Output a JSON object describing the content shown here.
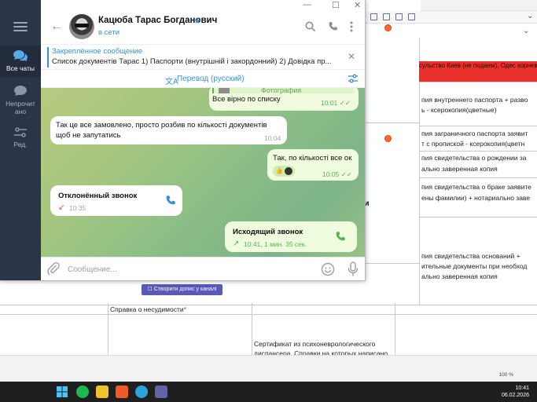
{
  "sidebar": {
    "folders": [
      {
        "label": "Все чаты",
        "active": true
      },
      {
        "label": "Непрочитано",
        "active": false
      },
      {
        "label": "Ред.",
        "active": false
      }
    ]
  },
  "header": {
    "title": "Кацюба Тарас Богданович",
    "status": "в сети"
  },
  "pinned": {
    "title": "Закреплённое сообщение",
    "text": "Список документів Тарас  1) Паспорти (внутрішній і закордонний) 2) Довідка пр..."
  },
  "translate": {
    "label": "Перевод (русский)"
  },
  "messages": {
    "photo": {
      "label": "Фотография",
      "text": "Все вірно по списку",
      "time": "10:01"
    },
    "split": {
      "text": "Так це все замовлено, просто розбив по кількості документів щоб не запутатись",
      "time": "10:04"
    },
    "count": {
      "text": "Так, по кількості все ок",
      "reaction": "👍",
      "time": "10:05"
    },
    "missed_call": {
      "title": "Отклонённый звонок",
      "time": "10:35"
    },
    "outgoing_call": {
      "title": "Исходящий звонок",
      "time": "10:41, 1 мин. 35 сек."
    }
  },
  "composer": {
    "placeholder": "Сообщение..."
  },
  "sheet": {
    "red_header": "сульство Киев (не подаем), Одес корневых)",
    "rows": [
      "пия внутреннего паспорта + разво",
      "ь - ксерокопия(цветные)",
      "пия заграничного паспорта заявит",
      "т с пропиской - ксерокопия(цветн",
      "пия свидетельства о рождении за",
      "ально заверенная копия",
      "пия свидетельства о браке заявите",
      "ены фамилии) + нотариально заве",
      "пия свидетельства оснований +",
      "ительные документы при необход",
      "ально заверенная копия"
    ],
    "bold_fragment": "ми",
    "canal_button": "Створити допис у каналі",
    "row_label": "Справка о несудимости",
    "certificate": [
      "Сертификат из психоневрологического",
      "диспансера. Справки на которых нарисано"
    ],
    "zoom": "100 %"
  },
  "taskbar": {
    "time": "10:41",
    "date": "06.02.2026"
  },
  "colors": {
    "accent": "#3a8fd9",
    "sidebar": "#2b3548",
    "outgoing_bubble": "#effdde",
    "missed": "#e25050",
    "sent_green": "#5fad55"
  }
}
